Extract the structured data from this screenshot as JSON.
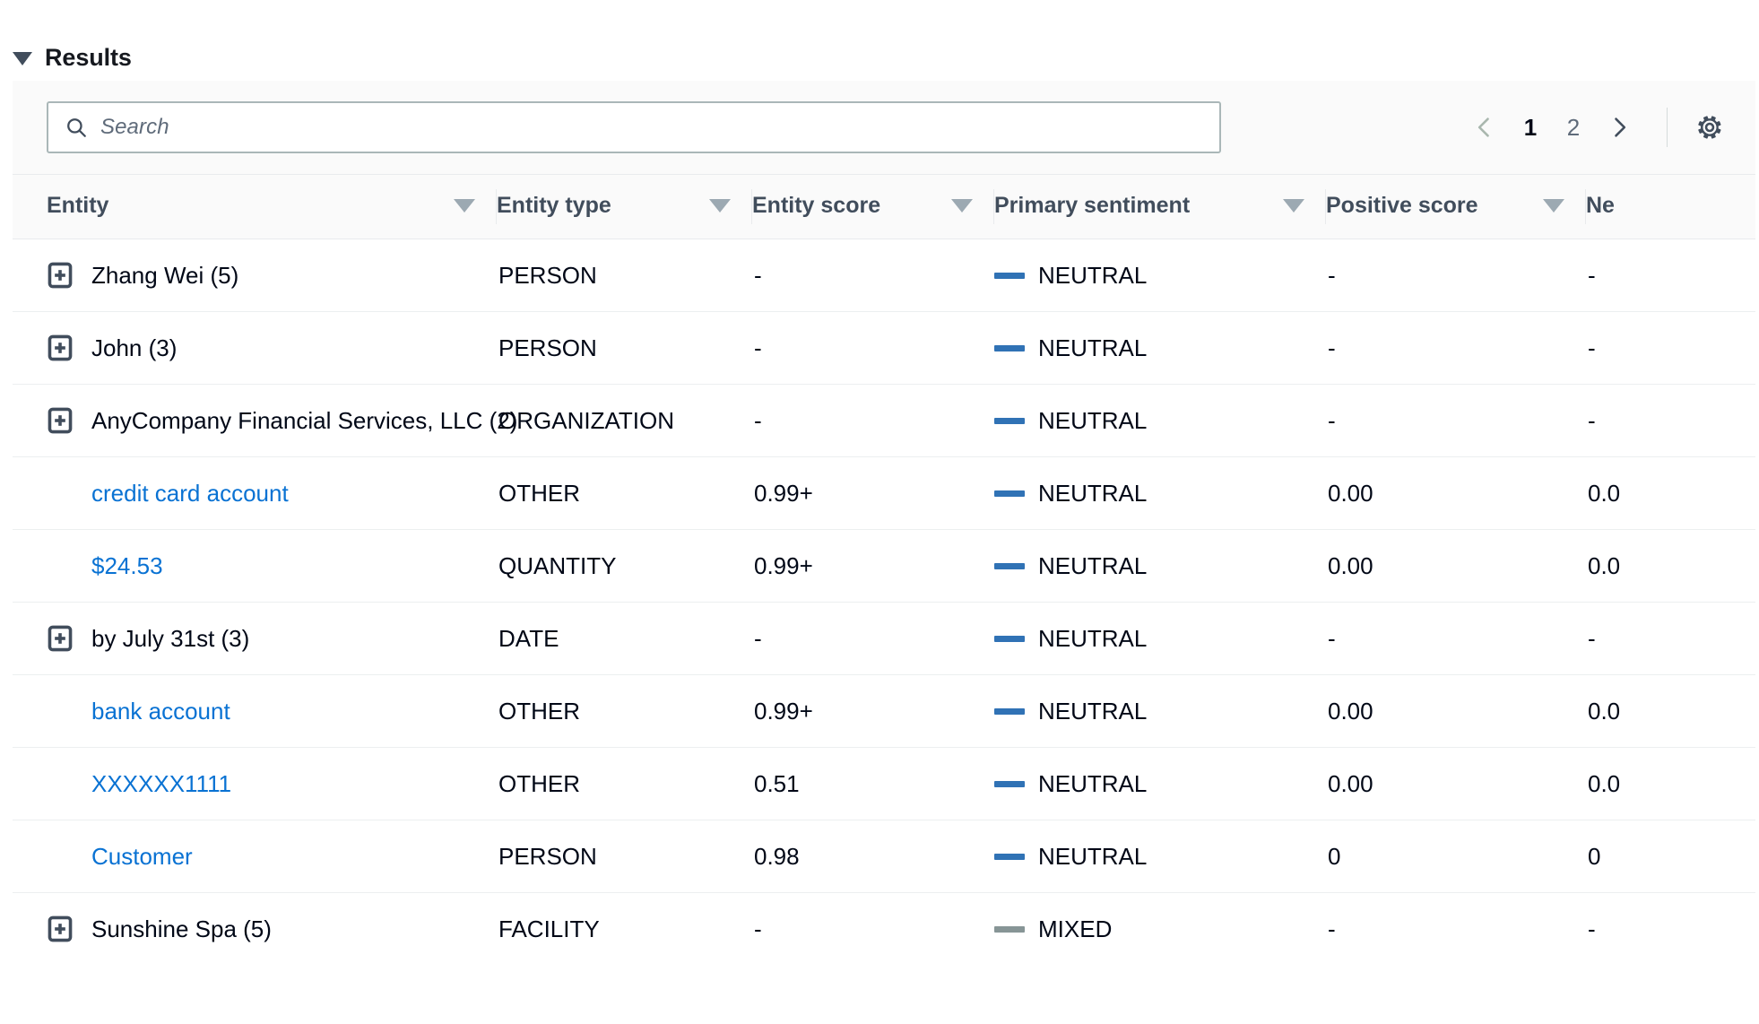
{
  "section": {
    "title": "Results",
    "collapse_icon": "triangle-down-icon"
  },
  "toolbar": {
    "search": {
      "placeholder": "Search",
      "value": "",
      "icon": "search-icon"
    },
    "pagination": {
      "prev_icon": "chevron-left-icon",
      "next_icon": "chevron-right-icon",
      "pages": [
        "1",
        "2"
      ],
      "current_page": "1"
    },
    "preferences": {
      "icon": "gear-icon"
    }
  },
  "table": {
    "columns": [
      {
        "label": "Entity",
        "sort_icon": "sort-triangle-icon"
      },
      {
        "label": "Entity type",
        "sort_icon": "sort-triangle-icon"
      },
      {
        "label": "Entity score",
        "sort_icon": "sort-triangle-icon"
      },
      {
        "label": "Primary sentiment",
        "sort_icon": "sort-triangle-icon"
      },
      {
        "label": "Positive score",
        "sort_icon": "sort-triangle-icon"
      },
      {
        "label": "Ne",
        "sort_icon": "sort-triangle-icon"
      }
    ],
    "rows": [
      {
        "expandable": true,
        "expand_icon": "expand-plus-icon",
        "link": false,
        "entity": "Zhang Wei (5)",
        "entity_type": "PERSON",
        "entity_score": "-",
        "sentiment": "NEUTRAL",
        "sentiment_color": "#3072b5",
        "positive_score": "-",
        "negative_score": "-"
      },
      {
        "expandable": true,
        "expand_icon": "expand-plus-icon",
        "link": false,
        "entity": "John (3)",
        "entity_type": "PERSON",
        "entity_score": "-",
        "sentiment": "NEUTRAL",
        "sentiment_color": "#3072b5",
        "positive_score": "-",
        "negative_score": "-"
      },
      {
        "expandable": true,
        "expand_icon": "expand-plus-icon",
        "link": false,
        "entity": "AnyCompany Financial Services, LLC (2)",
        "entity_type": "ORGANIZATION",
        "entity_score": "-",
        "sentiment": "NEUTRAL",
        "sentiment_color": "#3072b5",
        "positive_score": "-",
        "negative_score": "-"
      },
      {
        "expandable": false,
        "expand_icon": "",
        "link": true,
        "entity": "credit card account",
        "entity_type": "OTHER",
        "entity_score": "0.99+",
        "sentiment": "NEUTRAL",
        "sentiment_color": "#3072b5",
        "positive_score": "0.00",
        "negative_score": "0.0"
      },
      {
        "expandable": false,
        "expand_icon": "",
        "link": true,
        "entity": "$24.53",
        "entity_type": "QUANTITY",
        "entity_score": "0.99+",
        "sentiment": "NEUTRAL",
        "sentiment_color": "#3072b5",
        "positive_score": "0.00",
        "negative_score": "0.0"
      },
      {
        "expandable": true,
        "expand_icon": "expand-plus-icon",
        "link": false,
        "entity": "by July 31st (3)",
        "entity_type": "DATE",
        "entity_score": "-",
        "sentiment": "NEUTRAL",
        "sentiment_color": "#3072b5",
        "positive_score": "-",
        "negative_score": "-"
      },
      {
        "expandable": false,
        "expand_icon": "",
        "link": true,
        "entity": "bank account",
        "entity_type": "OTHER",
        "entity_score": "0.99+",
        "sentiment": "NEUTRAL",
        "sentiment_color": "#3072b5",
        "positive_score": "0.00",
        "negative_score": "0.0"
      },
      {
        "expandable": false,
        "expand_icon": "",
        "link": true,
        "entity": "XXXXXX1111",
        "entity_type": "OTHER",
        "entity_score": "0.51",
        "sentiment": "NEUTRAL",
        "sentiment_color": "#3072b5",
        "positive_score": "0.00",
        "negative_score": "0.0"
      },
      {
        "expandable": false,
        "expand_icon": "",
        "link": true,
        "entity": "Customer",
        "entity_type": "PERSON",
        "entity_score": "0.98",
        "sentiment": "NEUTRAL",
        "sentiment_color": "#3072b5",
        "positive_score": "0",
        "negative_score": "0"
      },
      {
        "expandable": true,
        "expand_icon": "expand-plus-icon",
        "link": false,
        "entity": "Sunshine Spa (5)",
        "entity_type": "FACILITY",
        "entity_score": "-",
        "sentiment": "MIXED",
        "sentiment_color": "#879596",
        "positive_score": "-",
        "negative_score": "-"
      }
    ]
  },
  "colors": {
    "link": "#0972d3",
    "neutral_bar": "#3072b5",
    "mixed_bar": "#879596",
    "header_text": "#414d5c",
    "toolbar_bg": "#fafafa"
  }
}
